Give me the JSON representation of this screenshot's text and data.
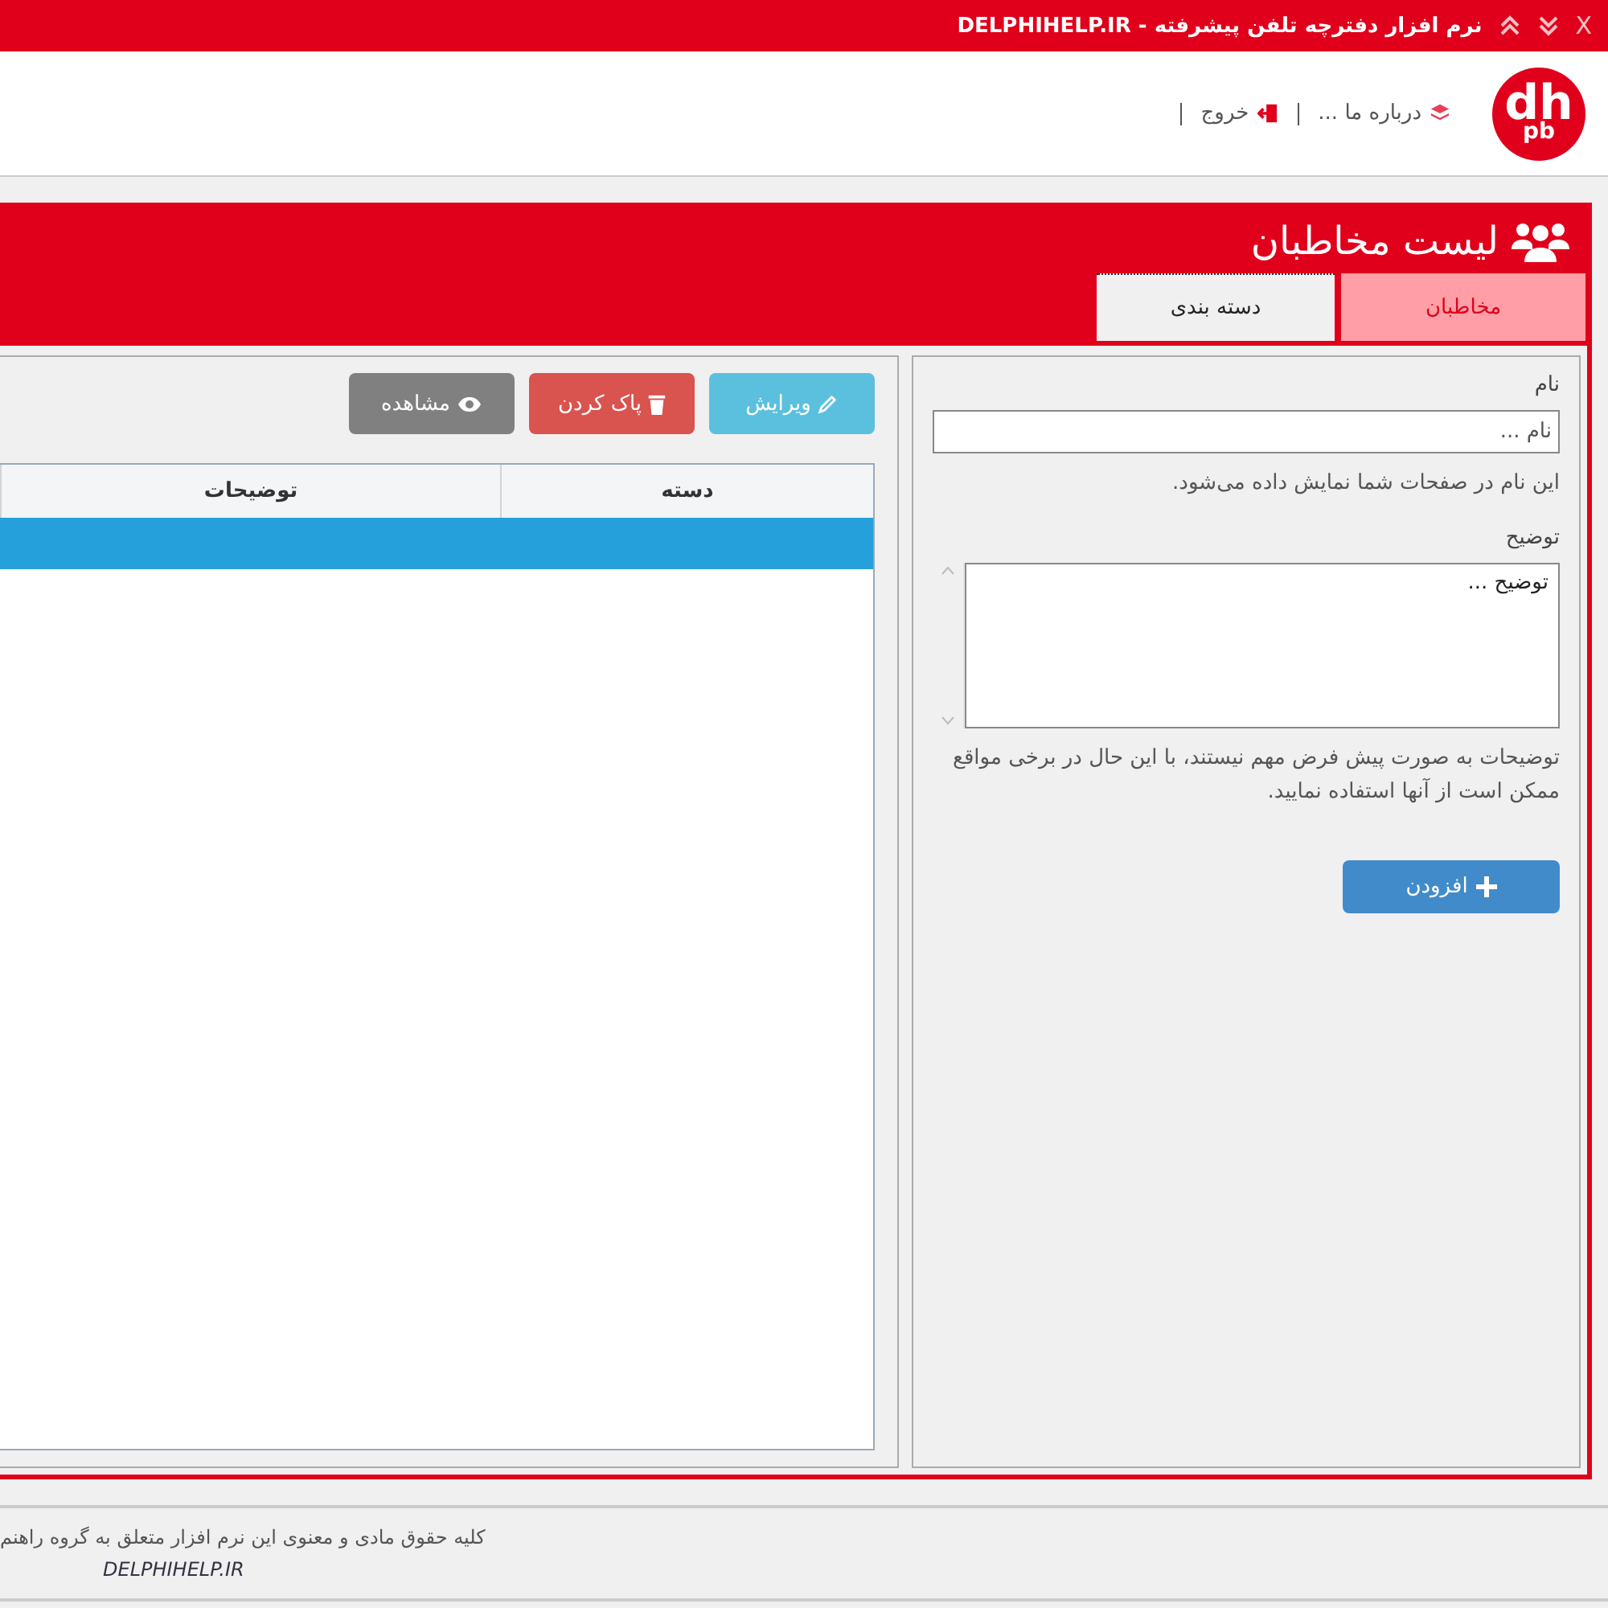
{
  "window": {
    "title": "نرم افزار دفترچه تلفن پیشرفته - DELPHIHELP.IR",
    "close_label": "X"
  },
  "header": {
    "logo": {
      "mark": "dh",
      "submark": "pb"
    },
    "links": [
      {
        "label": "درباره ما ...",
        "kind": "about"
      },
      {
        "label": "خروج",
        "kind": "exit"
      }
    ]
  },
  "panel": {
    "title": "لیست مخاطبان",
    "tabs": [
      {
        "label": "مخاطبان",
        "selected": false
      },
      {
        "label": "دسته بندی",
        "selected": true
      }
    ]
  },
  "form": {
    "name_label": "نام",
    "name_placeholder": "نام ...",
    "name_hint": "این نام در صفحات شما نمایش داده می‌شود.",
    "description_label": "توضیح",
    "description_placeholder": "توضیح ...",
    "description_hint": "توضیحات به صورت پیش فرض مهم نیستند، با این حال در برخی مواقع ممکن است از آنها استفاده نمایید.",
    "add_button": "افزودن"
  },
  "toolbar": [
    {
      "label": "ویرایش",
      "kind": "edit"
    },
    {
      "label": "پاک کردن",
      "kind": "delete"
    },
    {
      "label": "مشاهده",
      "kind": "view"
    }
  ],
  "table": {
    "columns": [
      "دسته",
      "توضیحات"
    ],
    "rows": [
      {
        "selected": true
      }
    ]
  },
  "footer": {
    "copyright": "کلیه حقوق مادی و معنوی این نرم افزار متعلق به گروه راهنم",
    "site": "DELPHIHELP.IR"
  }
}
